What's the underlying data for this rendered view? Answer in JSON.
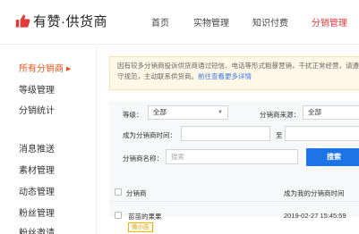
{
  "header": {
    "logo_text": "有赞·供货商",
    "nav": [
      {
        "label": "首页"
      },
      {
        "label": "实物管理"
      },
      {
        "label": "知识付费"
      },
      {
        "label": "分销管理",
        "active": true
      }
    ]
  },
  "sidebar": {
    "items": [
      {
        "label": "所有分销商",
        "active": true
      },
      {
        "label": "等级管理"
      },
      {
        "label": "分销统计"
      },
      {
        "label": "消息推送"
      },
      {
        "label": "素材管理"
      },
      {
        "label": "动态管理"
      },
      {
        "label": "粉丝管理"
      },
      {
        "label": "粉丝邀请"
      }
    ]
  },
  "notice": {
    "text": "因有较多分销商投诉供货商通过短信、电话等形式粗暴营销，干扰正常经营，请遵守规范，主动联系供货商。",
    "link": "前往查看更多详情"
  },
  "filters": {
    "level_label": "等级：",
    "level_value": "全部",
    "source_label": "分销商来源：",
    "source_value": "全部",
    "time_label": "成为分销商时间：",
    "time_separator": "至",
    "name_label": "分销商名称：",
    "name_placeholder": "搜索",
    "search_button": "搜索"
  },
  "table": {
    "columns": [
      "分销商",
      "成为我的分销商时间"
    ],
    "rows": [
      {
        "name": "苗苗的果果",
        "tag": "微小店",
        "time": "2019-02-27 15:45:59"
      }
    ]
  },
  "colors": {
    "accent": "#e33b3b",
    "sidebar_active": "#e8541e",
    "primary_button": "#1c74e6",
    "link": "#3878e6"
  }
}
